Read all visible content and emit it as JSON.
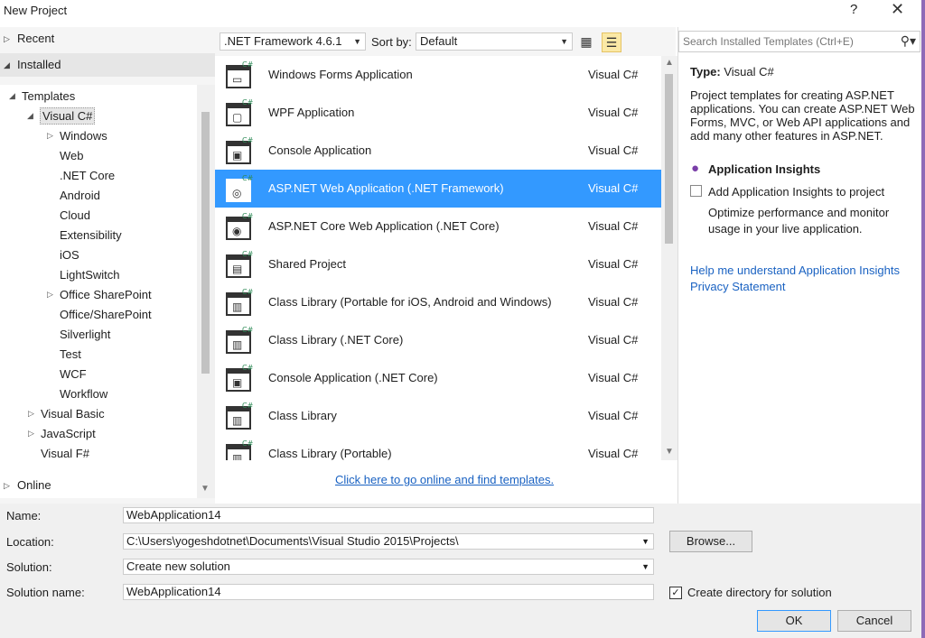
{
  "window": {
    "title": "New Project",
    "help": "?",
    "close": "✕"
  },
  "left": {
    "recent": "Recent",
    "installed": "Installed",
    "online": "Online",
    "tree": {
      "templates": "Templates",
      "visual_csharp": "Visual C#",
      "children": [
        "Windows",
        "Web",
        ".NET Core",
        "Android",
        "Cloud",
        "Extensibility",
        "iOS",
        "LightSwitch",
        "Office SharePoint",
        "Office/SharePoint",
        "Silverlight",
        "Test",
        "WCF",
        "Workflow"
      ],
      "visual_basic": "Visual Basic",
      "javascript": "JavaScript",
      "visual_fsharp": "Visual F#"
    }
  },
  "toolbar": {
    "framework": ".NET Framework 4.6.1",
    "sort_label": "Sort by:",
    "sort_value": "Default"
  },
  "search": {
    "placeholder": "Search Installed Templates (Ctrl+E)"
  },
  "templates": [
    {
      "name": "Windows Forms Application",
      "lang": "Visual C#",
      "icon": "winforms-icon"
    },
    {
      "name": "WPF Application",
      "lang": "Visual C#",
      "icon": "wpf-icon"
    },
    {
      "name": "Console Application",
      "lang": "Visual C#",
      "icon": "console-icon"
    },
    {
      "name": "ASP.NET Web Application (.NET Framework)",
      "lang": "Visual C#",
      "icon": "web-app-icon",
      "selected": true
    },
    {
      "name": "ASP.NET Core Web Application (.NET Core)",
      "lang": "Visual C#",
      "icon": "core-web-icon"
    },
    {
      "name": "Shared Project",
      "lang": "Visual C#",
      "icon": "shared-project-icon"
    },
    {
      "name": "Class Library (Portable for iOS, Android and Windows)",
      "lang": "Visual C#",
      "icon": "class-library-icon"
    },
    {
      "name": "Class Library (.NET Core)",
      "lang": "Visual C#",
      "icon": "class-library-core-icon"
    },
    {
      "name": "Console Application (.NET Core)",
      "lang": "Visual C#",
      "icon": "console-core-icon"
    },
    {
      "name": "Class Library",
      "lang": "Visual C#",
      "icon": "class-library-icon"
    },
    {
      "name": "Class Library (Portable)",
      "lang": "Visual C#",
      "icon": "class-library-icon"
    }
  ],
  "online_link": "Click here to go online and find templates.",
  "details": {
    "type_label": "Type:",
    "type_value": "Visual C#",
    "description": "Project templates for creating ASP.NET applications. You can create ASP.NET Web Forms, MVC, or Web API applications and add many other features in ASP.NET.",
    "ai_title": "Application Insights",
    "ai_checkbox": "Add Application Insights to project",
    "ai_desc": "Optimize performance and monitor usage in your live application.",
    "help_link": "Help me understand Application Insights",
    "privacy_link": "Privacy Statement"
  },
  "form": {
    "name_label": "Name:",
    "name_value": "WebApplication14",
    "location_label": "Location:",
    "location_value": "C:\\Users\\yogeshdotnet\\Documents\\Visual Studio 2015\\Projects\\",
    "browse": "Browse...",
    "solution_label": "Solution:",
    "solution_value": "Create new solution",
    "solution_name_label": "Solution name:",
    "solution_name_value": "WebApplication14",
    "create_dir": "Create directory for solution",
    "create_dir_checked": true,
    "ok": "OK",
    "cancel": "Cancel"
  },
  "colors": {
    "selection": "#3399ff",
    "link": "#1a62c2",
    "accent": "#8e6ab7"
  }
}
